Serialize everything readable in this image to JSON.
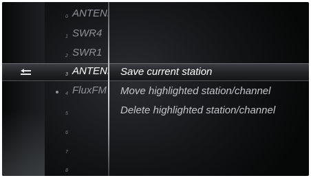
{
  "station_list": [
    {
      "number": "0",
      "name": "ANTENNE",
      "favorite": false
    },
    {
      "number": "1",
      "name": "SWR4",
      "favorite": false
    },
    {
      "number": "2",
      "name": "SWR1",
      "favorite": false
    },
    {
      "number": "3",
      "name": "ANTENNE",
      "favorite": false,
      "selected": true
    },
    {
      "number": "4",
      "name": "FluxFM",
      "favorite": true
    },
    {
      "number": "5",
      "name": "",
      "favorite": false
    },
    {
      "number": "6",
      "name": "",
      "favorite": false
    },
    {
      "number": "7",
      "name": "",
      "favorite": false
    },
    {
      "number": "8",
      "name": "",
      "favorite": false
    }
  ],
  "back_icon": "back-arrow-icon",
  "context_menu": {
    "items": [
      {
        "label": "Save current station",
        "selected": true
      },
      {
        "label": "Move highlighted station/channel",
        "selected": false
      },
      {
        "label": "Delete highlighted station/channel",
        "selected": false
      }
    ]
  },
  "colors": {
    "text": "#c4c6c9",
    "selected_text": "#ffffff",
    "background": "#141517"
  }
}
